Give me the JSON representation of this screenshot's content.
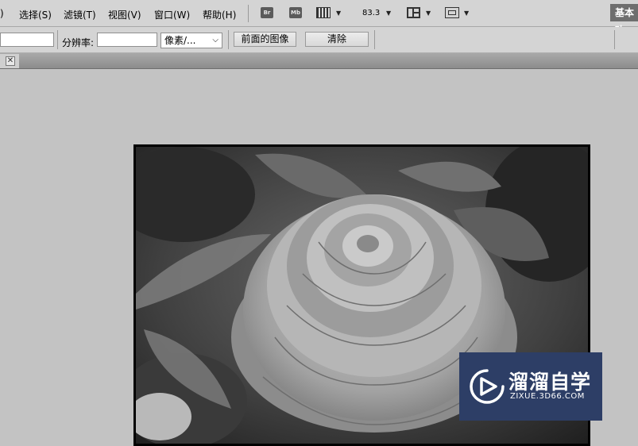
{
  "menu": {
    "items": [
      {
        "label": ")"
      },
      {
        "label": "选择(S)"
      },
      {
        "label": "滤镜(T)"
      },
      {
        "label": "视图(V)"
      },
      {
        "label": "窗口(W)"
      },
      {
        "label": "帮助(H)"
      }
    ],
    "toolbar": {
      "bridge_icon": "Br",
      "minibridge_icon": "Mb",
      "zoom": "83.3",
      "workspace": "基本功"
    }
  },
  "options": {
    "resolution_label": "分辨率:",
    "unit_select": "像素/...",
    "front_image_button": "前面的图像",
    "clear_button": "清除"
  },
  "tab": {
    "close_icon": "close-icon"
  },
  "watermark": {
    "title": "溜溜自学",
    "url": "ZIXUE.3D66.COM",
    "brand_color": "#2d3e66"
  }
}
